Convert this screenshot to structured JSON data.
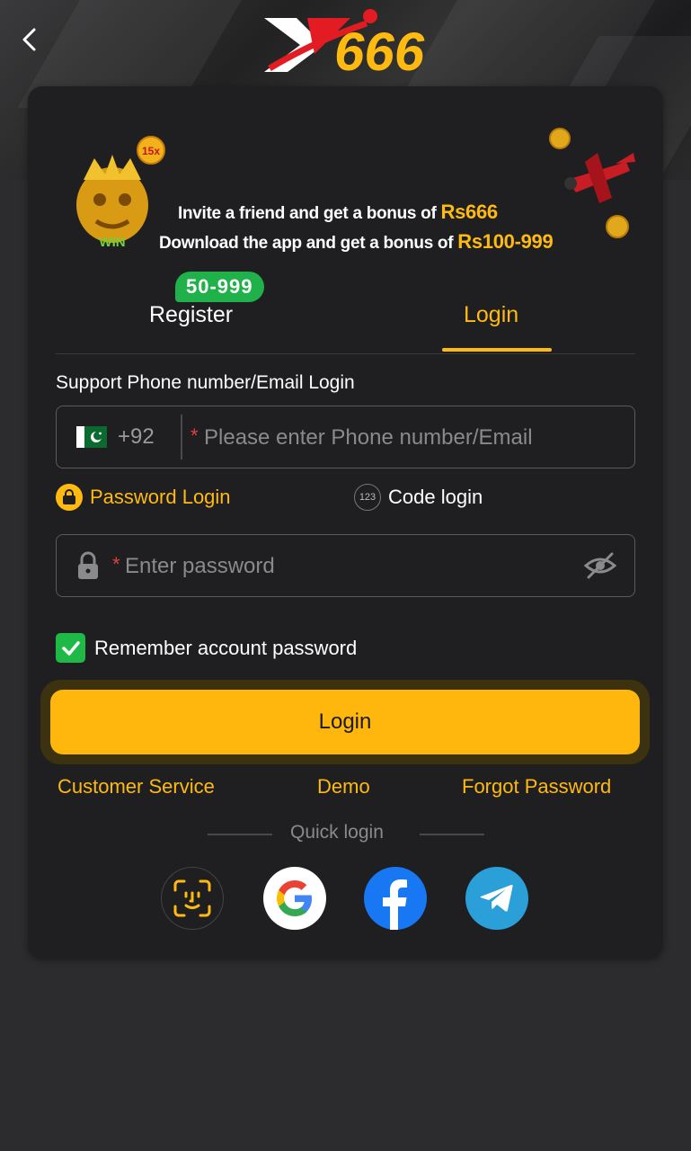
{
  "header": {
    "back_icon": "chevron-left-icon",
    "logo_text": "X666"
  },
  "banner": {
    "line1_prefix": "Invite a friend and get a bonus of ",
    "line1_highlight": "Rs666",
    "line2_prefix": "Download the app and get a bonus of ",
    "line2_highlight": "Rs100-999",
    "win_text": "WIN",
    "multiplier_text": "15x"
  },
  "tabs": {
    "register_label": "Register",
    "register_badge": "50-999",
    "login_label": "Login",
    "active": "Login"
  },
  "form": {
    "support_label": "Support Phone number/Email Login",
    "country_code": "+92",
    "phone_placeholder": "Please enter Phone number/Email",
    "required_mark": "*",
    "password_mode_label": "Password Login",
    "code_mode_label": "Code login",
    "code_icon_text": "123",
    "password_placeholder": "Enter password",
    "remember_label": "Remember account password",
    "remember_checked": true,
    "login_button": "Login"
  },
  "links": {
    "customer_service": "Customer Service",
    "demo": "Demo",
    "forgot_password": "Forgot Password"
  },
  "quick_login": {
    "label": "Quick login",
    "providers": [
      "face-id-icon",
      "google-icon",
      "facebook-icon",
      "telegram-icon"
    ]
  },
  "colors": {
    "accent": "#ffba12",
    "button": "#ffb60d",
    "card_bg": "#1f1f21",
    "page_bg": "#2c2c2e",
    "badge_green": "#21b14a",
    "checkbox_green": "#1fb948"
  }
}
